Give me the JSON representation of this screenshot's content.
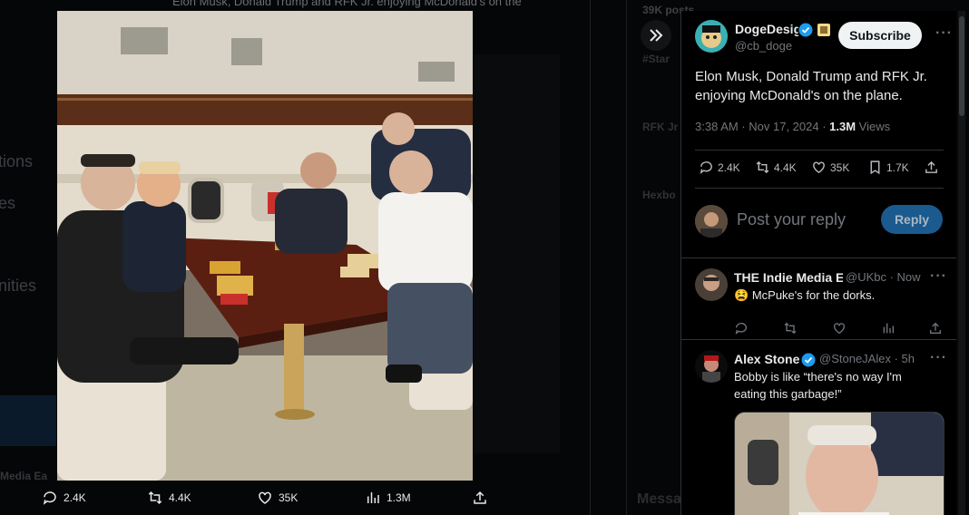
{
  "background": {
    "header_snippet": "Elon Musk, Donald Trump and RFK Jr. enjoying McDonald's on the",
    "side_labels": [
      "tions",
      "es",
      "nities"
    ],
    "right_labels": [
      "39K posts",
      "#Star",
      "RFK Jr",
      "Hexbo"
    ],
    "bottom_labels": [
      "Media Ea",
      "Messa"
    ]
  },
  "media": {
    "photo_alt": "Elon Musk, Donald Trump and RFK Jr. enjoying McDonald's on the plane."
  },
  "action_bar": {
    "replies": "2.4K",
    "reposts": "4.4K",
    "likes": "35K",
    "views": "1.3M"
  },
  "post": {
    "author_name": "DogeDesig",
    "author_handle": "@cb_doge",
    "subscribe_label": "Subscribe",
    "text": "Elon Musk, Donald Trump and RFK Jr. enjoying McDonald's on the plane.",
    "time": "3:38 AM · Nov 17, 2024 · ",
    "views_count": "1.3M",
    "views_label": " Views",
    "stats": {
      "replies": "2.4K",
      "reposts": "4.4K",
      "likes": "35K",
      "bookmarks": "1.7K"
    }
  },
  "reply_composer": {
    "placeholder": "Post your reply",
    "button": "Reply"
  },
  "comments": [
    {
      "name": "THE Indie Media E",
      "handle": "@UKbc · Now",
      "emoji": "😫",
      "text": "McPuke's for the dorks."
    },
    {
      "name": "Alex Stone",
      "handle": "@StoneJAlex · 5h",
      "text_line1": "Bobby is like “there's no way I'm",
      "text_line2": "eating this garbage!”"
    }
  ],
  "colors": {
    "verified_blue": "#1d9bf0",
    "reply_button": "#1a5a8f",
    "muted": "#71767b"
  }
}
